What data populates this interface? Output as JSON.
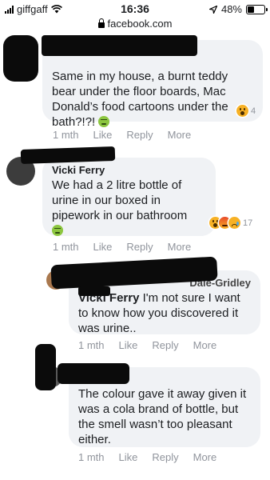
{
  "status_bar": {
    "carrier": "giffgaff",
    "time": "16:36",
    "battery": "48%",
    "battery_level": 0.48
  },
  "url_bar": {
    "domain": "facebook.com"
  },
  "comments": [
    {
      "text": "Same in my house, a burnt teddy bear under the floor boards, Mac Donald’s food cartoons under the bath?!?!",
      "reaction_count": "4",
      "time": "1 mth",
      "like": "Like",
      "reply": "Reply",
      "more": "More"
    },
    {
      "author": "Vicki Ferry",
      "text": "We had a 2 litre bottle of urine in our boxed in pipework in our bathroom",
      "reaction_count": "17",
      "time": "1 mth",
      "like": "Like",
      "reply": "Reply",
      "more": "More"
    },
    {
      "author": "Dale-Gridley",
      "mention": "Vicki Ferry",
      "text": " I'm not sure I want to know how you discovered it was urine..",
      "time": "1 mth",
      "like": "Like",
      "reply": "Reply",
      "more": "More"
    },
    {
      "text": "The colour gave it away given it was a cola brand of bottle, but the smell wasn’t too pleasant either.",
      "time": "1 mth",
      "like": "Like",
      "reply": "Reply",
      "more": "More"
    }
  ],
  "colors": {
    "bubble": "#f0f2f5",
    "meta": "#90949c",
    "text": "#1c1e21",
    "redaction": "#0b0b0b"
  }
}
